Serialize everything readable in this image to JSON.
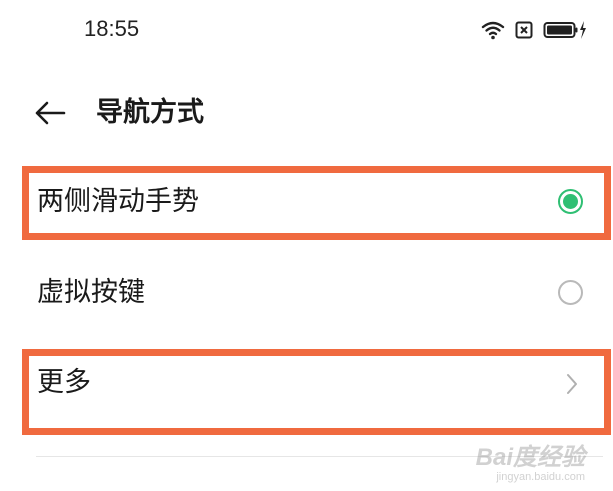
{
  "status_bar": {
    "time": "18:55",
    "icons": [
      "wifi-icon",
      "sim-card-icon",
      "battery-charging-icon"
    ]
  },
  "header": {
    "back_icon": "arrow-left-icon",
    "title": "导航方式"
  },
  "options": [
    {
      "label": "两侧滑动手势",
      "control": "radio",
      "selected": true
    },
    {
      "label": "虚拟按键",
      "control": "radio",
      "selected": false
    },
    {
      "label": "更多",
      "control": "chevron-right-icon"
    }
  ],
  "colors": {
    "accent_green": "#2fbf73",
    "highlight_orange": "#f06a3f",
    "text": "#1a1a1a"
  },
  "watermark": {
    "main": "Bai度经验",
    "sub": "jingyan.baidu.com"
  }
}
